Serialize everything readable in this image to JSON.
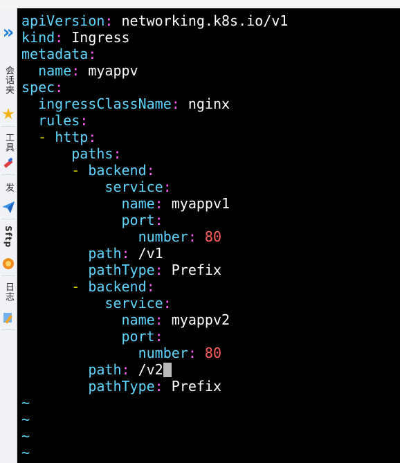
{
  "sidebar": {
    "items": [
      {
        "icon": "chevron-double-right-icon",
        "glyph": "»"
      },
      {
        "label": "会话夹",
        "icon": "star-icon",
        "glyph": "★"
      },
      {
        "label": "工具",
        "icon": "tool-icon",
        "glyph": "🔨"
      },
      {
        "label": "发",
        "icon": "send-icon",
        "glyph": "➤"
      },
      {
        "label": "Sftp",
        "icon": "sftp-icon",
        "glyph": "●"
      },
      {
        "label": "日志",
        "icon": "log-icon",
        "glyph": "✎"
      }
    ]
  },
  "editor": {
    "lines": [
      {
        "indent": "",
        "dash": "",
        "key": "apiVersion",
        "colon": ":",
        "value": " networking.k8s.io/v1",
        "num": ""
      },
      {
        "indent": "",
        "dash": "",
        "key": "kind",
        "colon": ":",
        "value": " Ingress",
        "num": ""
      },
      {
        "indent": "",
        "dash": "",
        "key": "metadata",
        "colon": ":",
        "value": "",
        "num": ""
      },
      {
        "indent": "  ",
        "dash": "",
        "key": "name",
        "colon": ":",
        "value": " myappv",
        "num": ""
      },
      {
        "indent": "",
        "dash": "",
        "key": "spec",
        "colon": ":",
        "value": "",
        "num": ""
      },
      {
        "indent": "  ",
        "dash": "",
        "key": "ingressClassName",
        "colon": ":",
        "value": " nginx",
        "num": ""
      },
      {
        "indent": "  ",
        "dash": "",
        "key": "rules",
        "colon": ":",
        "value": "",
        "num": ""
      },
      {
        "indent": "  ",
        "dash": "- ",
        "key": "http",
        "colon": ":",
        "value": "",
        "num": ""
      },
      {
        "indent": "      ",
        "dash": "",
        "key": "paths",
        "colon": ":",
        "value": "",
        "num": ""
      },
      {
        "indent": "      ",
        "dash": "- ",
        "key": "backend",
        "colon": ":",
        "value": "",
        "num": ""
      },
      {
        "indent": "          ",
        "dash": "",
        "key": "service",
        "colon": ":",
        "value": "",
        "num": ""
      },
      {
        "indent": "            ",
        "dash": "",
        "key": "name",
        "colon": ":",
        "value": " myappv1",
        "num": ""
      },
      {
        "indent": "            ",
        "dash": "",
        "key": "port",
        "colon": ":",
        "value": "",
        "num": ""
      },
      {
        "indent": "              ",
        "dash": "",
        "key": "number",
        "colon": ":",
        "value": " ",
        "num": "80"
      },
      {
        "indent": "        ",
        "dash": "",
        "key": "path",
        "colon": ":",
        "value": " /v1",
        "num": ""
      },
      {
        "indent": "        ",
        "dash": "",
        "key": "pathType",
        "colon": ":",
        "value": " Prefix",
        "num": ""
      },
      {
        "indent": "      ",
        "dash": "- ",
        "key": "backend",
        "colon": ":",
        "value": "",
        "num": ""
      },
      {
        "indent": "          ",
        "dash": "",
        "key": "service",
        "colon": ":",
        "value": "",
        "num": ""
      },
      {
        "indent": "            ",
        "dash": "",
        "key": "name",
        "colon": ":",
        "value": " myappv2",
        "num": ""
      },
      {
        "indent": "            ",
        "dash": "",
        "key": "port",
        "colon": ":",
        "value": "",
        "num": ""
      },
      {
        "indent": "              ",
        "dash": "",
        "key": "number",
        "colon": ":",
        "value": " ",
        "num": "80"
      },
      {
        "indent": "        ",
        "dash": "",
        "key": "path",
        "colon": ":",
        "value": " /v2",
        "num": "",
        "cursor": true
      },
      {
        "indent": "        ",
        "dash": "",
        "key": "pathType",
        "colon": ":",
        "value": " Prefix",
        "num": ""
      }
    ],
    "tildes": [
      "~",
      "~",
      "~",
      "~"
    ]
  },
  "colors": {
    "key": "#5fd7ff",
    "colon": "#ff5fff",
    "number": "#ff5f5f",
    "dash": "#d7d700",
    "background": "#000000"
  }
}
